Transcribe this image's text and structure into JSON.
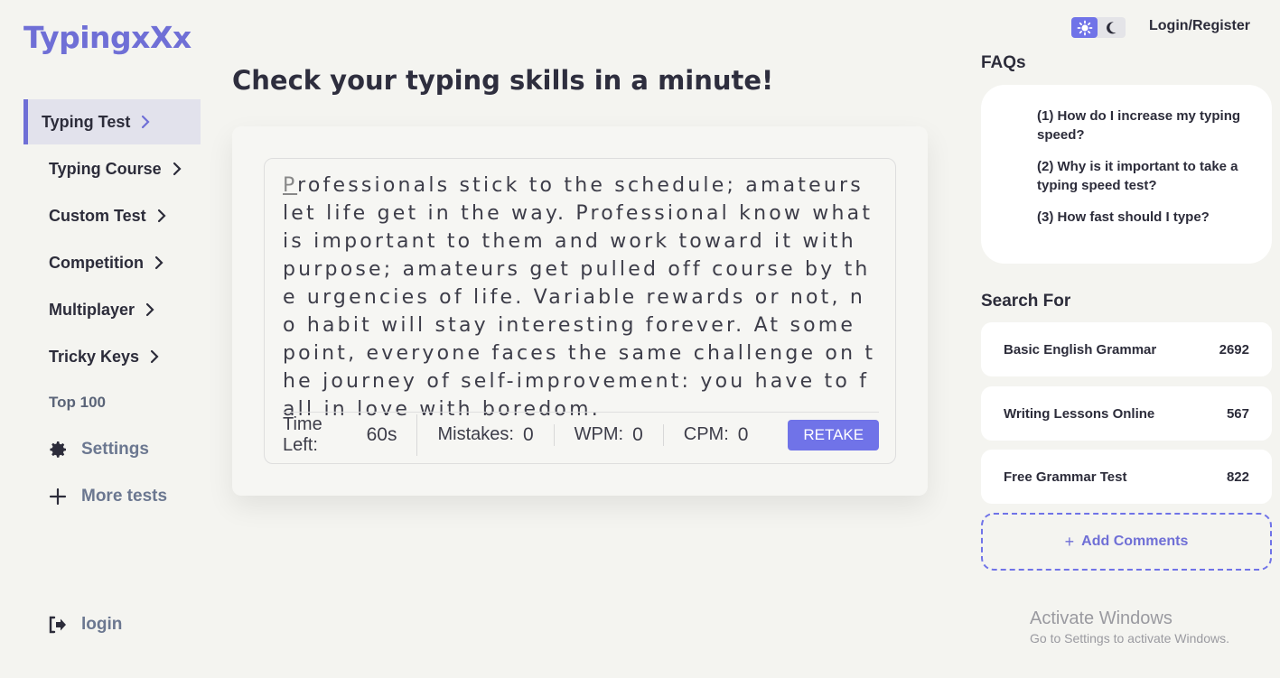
{
  "app": {
    "logo": "TypingxXx",
    "accent": "#6f6fd6",
    "button_color": "#7073e8"
  },
  "sidebar": {
    "items": [
      {
        "label": "Typing Test",
        "active": true
      },
      {
        "label": "Typing Course"
      },
      {
        "label": "Custom Test"
      },
      {
        "label": "Competition"
      },
      {
        "label": "Multiplayer"
      },
      {
        "label": "Tricky Keys"
      }
    ],
    "top100": "Top 100",
    "settings": "Settings",
    "more_tests": "More tests",
    "login": "login"
  },
  "main": {
    "headline": "Check your typing skills in a minute!",
    "first_char": "P",
    "text_rest": "rofessionals stick to the schedule; amateurs let life get in the way. Professional know what is important to them and work toward it with purpose; amateurs get pulled off course by the urgencies of life. Variable rewards or not, no habit will stay interesting forever. At some point, everyone faces the same challenge on the journey of self-improvement: you have to fall in love with boredom.",
    "stats": {
      "time_label": "Time Left:",
      "time_value": "60s",
      "mistakes_label": "Mistakes:",
      "mistakes_value": "0",
      "wpm_label": "WPM:",
      "wpm_value": "0",
      "cpm_label": "CPM:",
      "cpm_value": "0"
    },
    "retake_label": "RETAKE"
  },
  "header": {
    "login_register": "Login/Register",
    "theme_icons": [
      "sun-icon",
      "moon-icon"
    ]
  },
  "faqs": {
    "title": "FAQs",
    "items": [
      "(1) How do I increase my typing speed?",
      "(2) Why is it important to take a typing speed test?",
      "(3) How fast should I type?"
    ]
  },
  "search": {
    "title": "Search For",
    "items": [
      {
        "label": "Basic English Grammar",
        "count": "2692"
      },
      {
        "label": "Writing Lessons Online",
        "count": "567"
      },
      {
        "label": "Free Grammar Test",
        "count": "822"
      }
    ]
  },
  "add_comments": {
    "plus": "+",
    "label": "Add Comments"
  },
  "watermark": {
    "line1": "Activate Windows",
    "line2": "Go to Settings to activate Windows."
  }
}
